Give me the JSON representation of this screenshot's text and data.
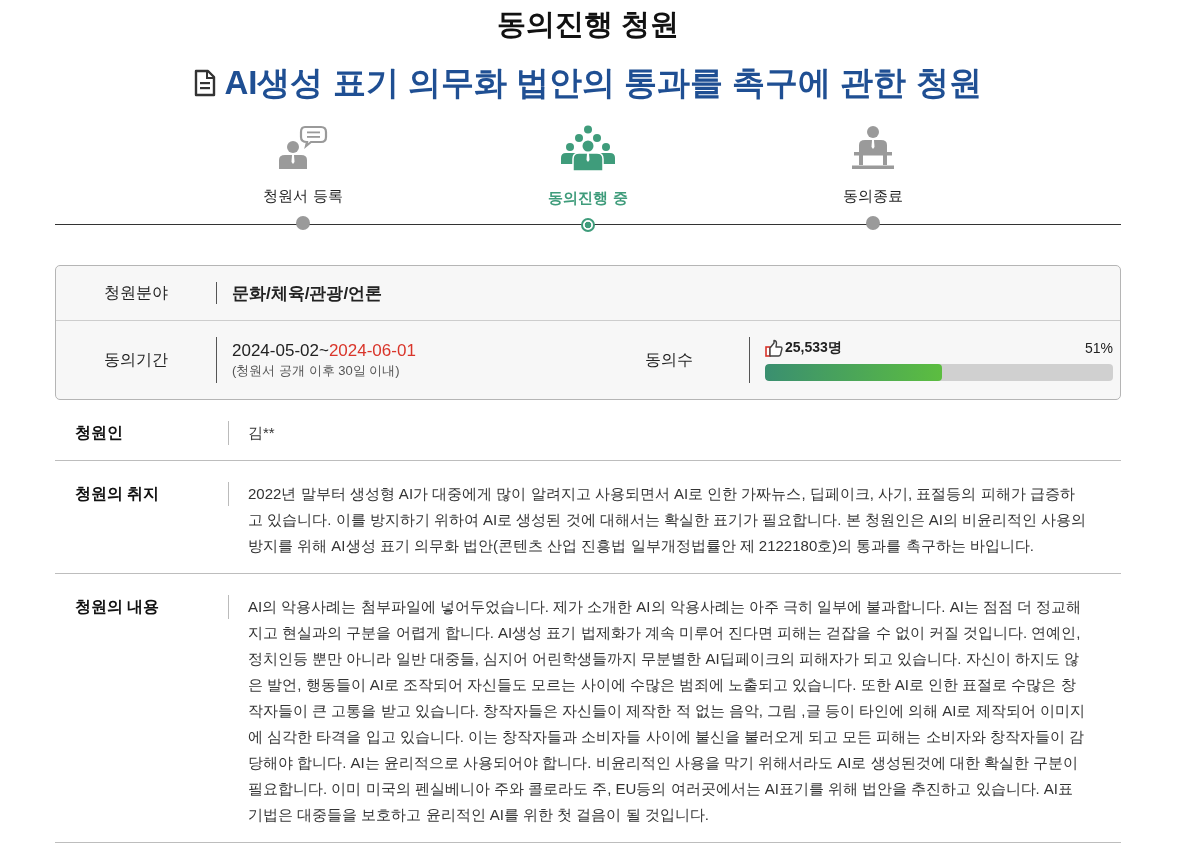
{
  "page": {
    "heading": "동의진행 청원",
    "title": "AI생성 표기 의무화 법안의 통과를 촉구에 관한 청원"
  },
  "steps": [
    {
      "kind": "register",
      "label": "청원서 등록",
      "selected": false
    },
    {
      "kind": "consent",
      "label": "동의진행 중",
      "selected": true
    },
    {
      "kind": "closed",
      "label": "동의종료",
      "selected": false
    }
  ],
  "summary": {
    "field_label": "청원분야",
    "field_value": "문화/체육/관광/언론",
    "period_label": "동의기간",
    "period_start": "2024-05-02~",
    "period_end": "2024-06-01",
    "period_note": "(청원서 공개 이후 30일 이내)",
    "count_label": "동의수",
    "count": "25,533명",
    "percent": "51%",
    "level": 0.51
  },
  "details": [
    {
      "label": "청원인",
      "text": "김**"
    },
    {
      "label": "청원의 취지",
      "text": "2022년 말부터 생성형 AI가 대중에게 많이 알려지고 사용되면서 AI로 인한 가짜뉴스, 딥페이크, 사기, 표절등의 피해가 급증하고 있습니다. 이를 방지하기 위하여 AI로 생성된 것에 대해서는 확실한 표기가 필요합니다. 본 청원인은 AI의 비윤리적인 사용의 방지를 위해 AI생성 표기 의무화 법안(콘텐츠 산업 진흥법 일부개정법률안 제 2122180호)의 통과를 촉구하는 바입니다."
    },
    {
      "label": "청원의 내용",
      "text": "AI의 악용사례는 첨부파일에 넣어두었습니다. 제가 소개한 AI의 악용사례는 아주 극히 일부에 불과합니다. AI는 점점 더 정교해지고 현실과의 구분을 어렵게 합니다. AI생성 표기 법제화가 계속 미루어 진다면 피해는 걷잡을 수 없이 커질 것입니다. 연예인, 정치인등 뿐만 아니라 일반 대중들, 심지어 어린학생들까지 무분별한 AI딥페이크의 피해자가 되고 있습니다. 자신이 하지도 않은 발언, 행동들이 AI로 조작되어 자신들도 모르는 사이에 수많은 범죄에 노출되고 있습니다. 또한 AI로 인한 표절로 수많은 창작자들이 큰 고통을 받고 있습니다. 창작자들은 자신들이 제작한 적 없는 음악, 그림 ,글 등이 타인에 의해 AI로 제작되어 이미지에 심각한 타격을 입고 있습니다. 이는 창작자들과 소비자들 사이에 불신을 불러오게 되고 모든 피해는 소비자와 창작자들이 감당해야 합니다. AI는 윤리적으로 사용되어야 합니다. 비윤리적인 사용을 막기 위해서라도 AI로 생성된것에 대한 확실한 구분이 필요합니다. 이미 미국의 펜실베니아 주와 콜로라도 주, EU등의 여러곳에서는 AI표기를 위해 법안을 추진하고 있습니다. AI표기법은 대중들을 보호하고 윤리적인 AI를 위한 첫 걸음이 될 것입니다."
    }
  ]
}
